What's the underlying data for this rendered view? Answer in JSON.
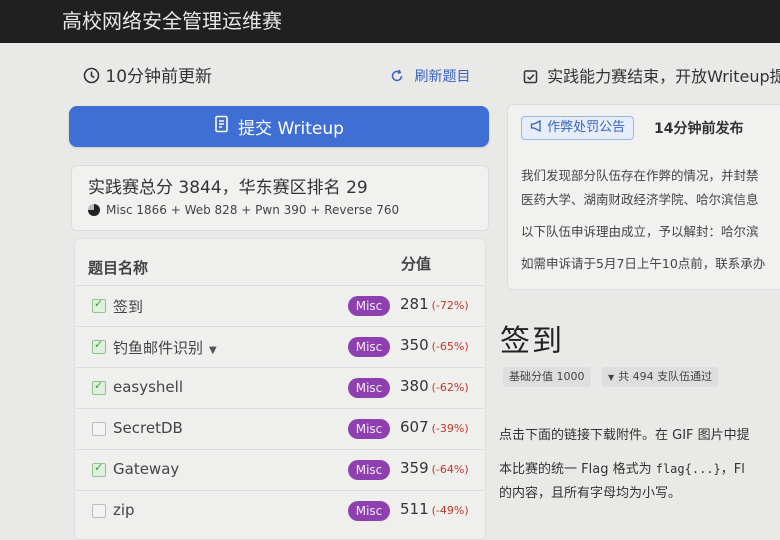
{
  "app": {
    "title": "高校网络安全管理运维赛"
  },
  "left": {
    "updated_text": "10分钟前更新",
    "refresh_label": "刷新题目",
    "submit_writeup_label": "提交 Writeup",
    "score_summary": "实践赛总分 3844，华东赛区排名 29",
    "score_breakdown": "Misc 1866 + Web 828 + Pwn 390 + Reverse 760",
    "table": {
      "col_name": "题目名称",
      "col_score": "分值",
      "rows": [
        {
          "name": "签到",
          "category": "Misc",
          "score": "281",
          "change": "(-72%)",
          "solved": true,
          "dropdown": false
        },
        {
          "name": "钓鱼邮件识别",
          "category": "Misc",
          "score": "350",
          "change": "(-65%)",
          "solved": true,
          "dropdown": true
        },
        {
          "name": "easyshell",
          "category": "Misc",
          "score": "380",
          "change": "(-62%)",
          "solved": true,
          "dropdown": false
        },
        {
          "name": "SecretDB",
          "category": "Misc",
          "score": "607",
          "change": "(-39%)",
          "solved": false,
          "dropdown": false
        },
        {
          "name": "Gateway",
          "category": "Misc",
          "score": "359",
          "change": "(-64%)",
          "solved": true,
          "dropdown": false
        },
        {
          "name": "zip",
          "category": "Misc",
          "score": "511",
          "change": "(-49%)",
          "solved": false,
          "dropdown": false
        }
      ]
    }
  },
  "right": {
    "notice_header": "实践能力赛结束，开放Writeup提",
    "announcement": {
      "tag": "作弊处罚公告",
      "time": "14分钟前发布",
      "line1": "我们发现部分队伍存在作弊的情况，并封禁",
      "line2": "医药大学、湖南财政经济学院、哈尔滨信息",
      "line3": "以下队伍申诉理由成立，予以解封：哈尔滨",
      "line4": "如需申诉请于5月7日上午10点前，联系承办"
    },
    "challenge": {
      "title": "签到",
      "base_score": "基础分值 1000",
      "solved_by": "共 494 支队伍通过",
      "desc1": "点击下面的链接下载附件。在 GIF 图片中提",
      "desc2_prefix": "本比赛的统一 Flag 格式为 ",
      "desc2_code": "flag{...}",
      "desc2_suffix": "，Fl",
      "desc3": "的内容，且所有字母均为小写。"
    }
  },
  "colors": {
    "accent": "#3f6fd4",
    "misc_badge": "#8e3fb0",
    "topbar": "#202020",
    "penalty": "#c0392b"
  }
}
